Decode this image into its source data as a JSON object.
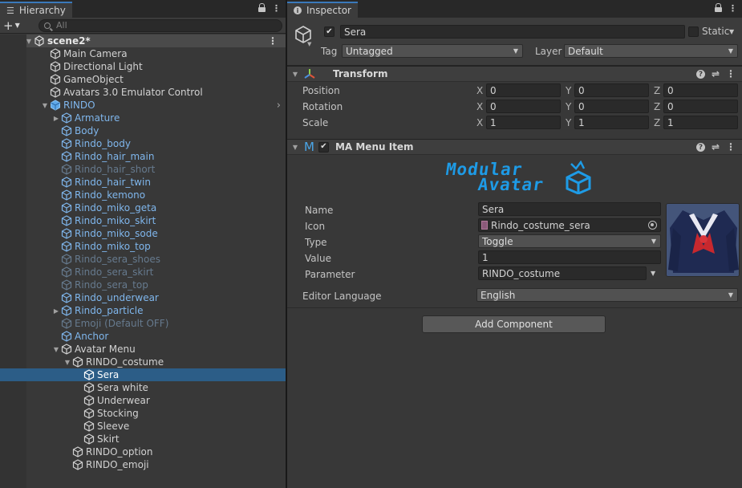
{
  "hierarchy": {
    "tab_title": "Hierarchy",
    "search_placeholder": "All",
    "add_label": "+",
    "scene": "scene2*",
    "rows": [
      {
        "label": "Main Camera",
        "color": "white",
        "depth": 1,
        "arrow": ""
      },
      {
        "label": "Directional Light",
        "color": "white",
        "depth": 1,
        "arrow": ""
      },
      {
        "label": "GameObject",
        "color": "white",
        "depth": 1,
        "arrow": ""
      },
      {
        "label": "Avatars 3.0 Emulator Control",
        "color": "white",
        "depth": 1,
        "arrow": ""
      },
      {
        "label": "RINDO",
        "color": "blue",
        "depth": 1,
        "arrow": "▼",
        "prefab": true,
        "chevron": "›"
      },
      {
        "label": "Armature",
        "color": "blue",
        "depth": 2,
        "arrow": "▶"
      },
      {
        "label": "Body",
        "color": "blue",
        "depth": 2,
        "arrow": ""
      },
      {
        "label": "Rindo_body",
        "color": "blue",
        "depth": 2,
        "arrow": ""
      },
      {
        "label": "Rindo_hair_main",
        "color": "blue",
        "depth": 2,
        "arrow": ""
      },
      {
        "label": "Rindo_hair_short",
        "color": "dim",
        "depth": 2,
        "arrow": ""
      },
      {
        "label": "Rindo_hair_twin",
        "color": "blue",
        "depth": 2,
        "arrow": ""
      },
      {
        "label": "Rindo_kemono",
        "color": "blue",
        "depth": 2,
        "arrow": ""
      },
      {
        "label": "Rindo_miko_geta",
        "color": "blue",
        "depth": 2,
        "arrow": ""
      },
      {
        "label": "Rindo_miko_skirt",
        "color": "blue",
        "depth": 2,
        "arrow": ""
      },
      {
        "label": "Rindo_miko_sode",
        "color": "blue",
        "depth": 2,
        "arrow": ""
      },
      {
        "label": "Rindo_miko_top",
        "color": "blue",
        "depth": 2,
        "arrow": ""
      },
      {
        "label": "Rindo_sera_shoes",
        "color": "dim",
        "depth": 2,
        "arrow": ""
      },
      {
        "label": "Rindo_sera_skirt",
        "color": "dim",
        "depth": 2,
        "arrow": ""
      },
      {
        "label": "Rindo_sera_top",
        "color": "dim",
        "depth": 2,
        "arrow": ""
      },
      {
        "label": "Rindo_underwear",
        "color": "blue",
        "depth": 2,
        "arrow": ""
      },
      {
        "label": "Rindo_particle",
        "color": "blue",
        "depth": 2,
        "arrow": "▶"
      },
      {
        "label": "Emoji (Default OFF)",
        "color": "dim",
        "depth": 2,
        "arrow": ""
      },
      {
        "label": "Anchor",
        "color": "blue",
        "depth": 2,
        "arrow": ""
      },
      {
        "label": "Avatar Menu",
        "color": "white",
        "depth": 2,
        "arrow": "▼"
      },
      {
        "label": "RINDO_costume",
        "color": "white",
        "depth": 3,
        "arrow": "▼"
      },
      {
        "label": "Sera",
        "color": "white",
        "depth": 4,
        "arrow": "",
        "selected": true
      },
      {
        "label": "Sera white",
        "color": "white",
        "depth": 4,
        "arrow": ""
      },
      {
        "label": "Underwear",
        "color": "white",
        "depth": 4,
        "arrow": ""
      },
      {
        "label": "Stocking",
        "color": "white",
        "depth": 4,
        "arrow": ""
      },
      {
        "label": "Sleeve",
        "color": "white",
        "depth": 4,
        "arrow": ""
      },
      {
        "label": "Skirt",
        "color": "white",
        "depth": 4,
        "arrow": ""
      },
      {
        "label": "RINDO_option",
        "color": "white",
        "depth": 3,
        "arrow": ""
      },
      {
        "label": "RINDO_emoji",
        "color": "white",
        "depth": 3,
        "arrow": ""
      }
    ]
  },
  "inspector": {
    "tab_title": "Inspector",
    "object_name": "Sera",
    "static_label": "Static",
    "tag_label": "Tag",
    "tag_value": "Untagged",
    "layer_label": "Layer",
    "layer_value": "Default",
    "transform": {
      "title": "Transform",
      "rows": [
        {
          "label": "Position",
          "x": "0",
          "y": "0",
          "z": "0"
        },
        {
          "label": "Rotation",
          "x": "0",
          "y": "0",
          "z": "0"
        },
        {
          "label": "Scale",
          "x": "1",
          "y": "1",
          "z": "1"
        }
      ],
      "axis_x": "X",
      "axis_y": "Y",
      "axis_z": "Z"
    },
    "menu_item": {
      "title": "MA Menu Item",
      "logo_line1": "Modular",
      "logo_line2": "Avatar",
      "name_label": "Name",
      "name_value": "Sera",
      "icon_label": "Icon",
      "icon_value": "Rindo_costume_sera",
      "type_label": "Type",
      "type_value": "Toggle",
      "value_label": "Value",
      "value_value": "1",
      "parameter_label": "Parameter",
      "parameter_value": "RINDO_costume",
      "editor_language_label": "Editor Language",
      "editor_language_value": "English"
    },
    "add_component": "Add Component"
  },
  "colors": {
    "accent": "#3a79bb",
    "selected_row": "#2c5d87",
    "prefab_blue": "#7fb6ec",
    "logo_blue": "#1e9be6"
  }
}
